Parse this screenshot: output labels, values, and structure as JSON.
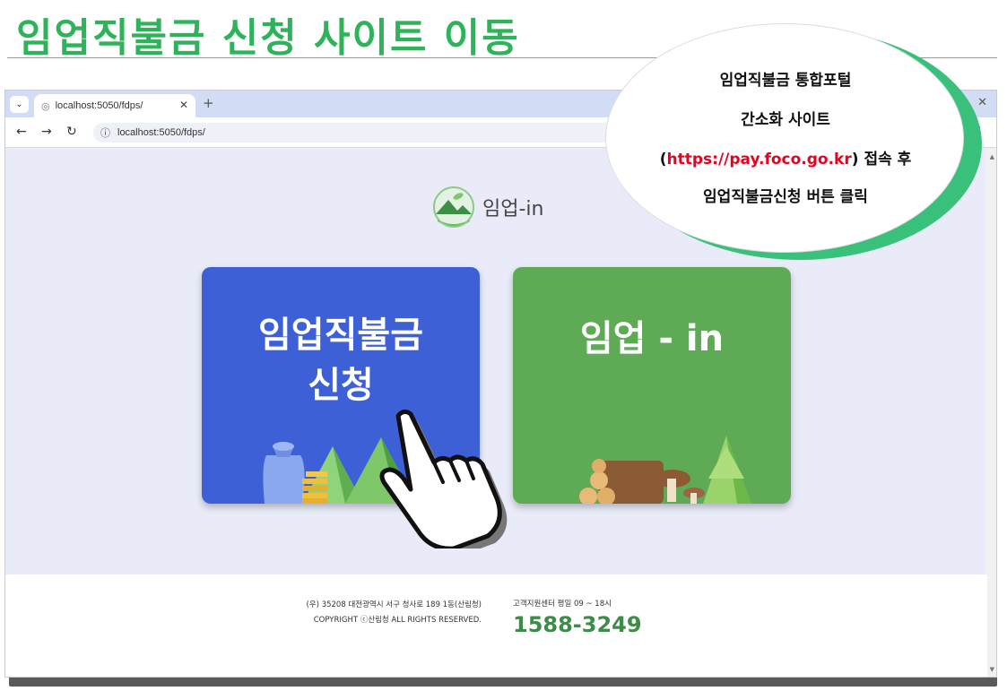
{
  "slide": {
    "title": "임업직불금 신청 사이트 이동"
  },
  "browser": {
    "tab_title": "localhost:5050/fdps/",
    "tab_close": "✕",
    "new_tab": "+",
    "window_close": "✕",
    "address_url": "localhost:5050/fdps/"
  },
  "site": {
    "logo_text": "임업-in",
    "cards": [
      {
        "title_line1": "임업직불금",
        "title_line2": "신청",
        "color": "#3e60d6"
      },
      {
        "title_line1": "임업 - in",
        "color": "#5eaa55"
      }
    ],
    "footer": {
      "address_line1": "(우) 35208 대전광역시 서구 청사로 189 1동(산림청)",
      "address_line2": "COPYRIGHT ⓒ산림청 ALL RIGHTS RESERVED.",
      "support_label": "고객지원센터 평일 09 ~ 18시",
      "support_phone": "1588-3249"
    }
  },
  "callout": {
    "line1": "임업직불금 통합포털",
    "line2": "간소화 사이트",
    "line3_open": "(",
    "line3_url": "https://pay.foco.go.kr",
    "line3_close": ") 접속 후",
    "line4": "임업직불금신청 버튼 클릭"
  },
  "colors": {
    "title_green": "#2fb35a",
    "callout_border": "#39c07a",
    "url_red": "#e8001e",
    "phone_green": "#3d8c48"
  },
  "icons": [
    "chevron-down-icon",
    "globe-icon",
    "back-arrow-icon",
    "forward-arrow-icon",
    "reload-icon",
    "info-icon",
    "kebab-menu-icon",
    "pointing-hand-icon"
  ]
}
